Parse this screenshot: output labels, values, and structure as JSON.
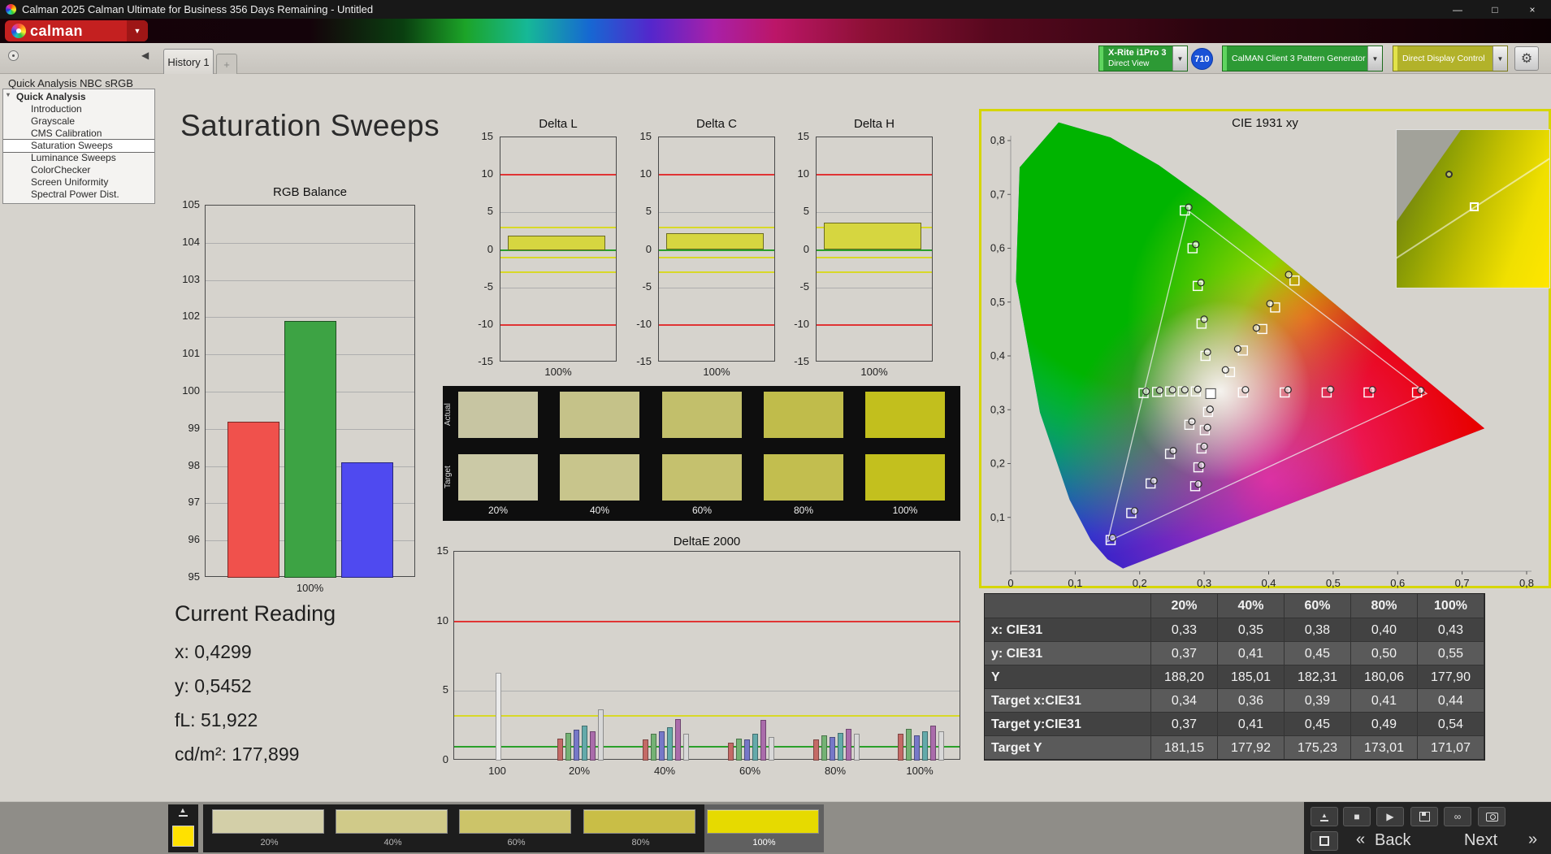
{
  "window": {
    "title": "Calman 2025 Calman Ultimate for Business 356 Days Remaining  - Untitled"
  },
  "logo": {
    "text": "calman"
  },
  "tabs": {
    "history": "History 1",
    "add": "+"
  },
  "toolbar": {
    "meter_line1": "X-Rite i1Pro 3",
    "meter_line2": "Direct View",
    "badge": "710",
    "pattern_generator": "CalMAN Client 3 Pattern Generator",
    "display_control": "Direct Display Control"
  },
  "icons": {
    "dropdown_arrow": "▼",
    "gear": "⚙",
    "minimize": "—",
    "maximize": "□",
    "close": "×",
    "collapse_left": "◀",
    "stop": "■",
    "play": "▶",
    "infinity": "∞",
    "back_chevrons": "«",
    "next_chevrons": "»"
  },
  "sidebar": {
    "header": "Quick Analysis NBC sRGB",
    "root": "Quick Analysis",
    "items": [
      {
        "label": "Introduction"
      },
      {
        "label": "Grayscale"
      },
      {
        "label": "CMS Calibration"
      },
      {
        "label": "Saturation Sweeps",
        "selected": true
      },
      {
        "label": "Luminance Sweeps"
      },
      {
        "label": "ColorChecker"
      },
      {
        "label": "Screen Uniformity"
      },
      {
        "label": "Spectral Power Dist."
      }
    ]
  },
  "main": {
    "title": "Saturation Sweeps"
  },
  "current_reading": {
    "title": "Current Reading",
    "line_x": "x: 0,4299",
    "line_y": "y: 0,5452",
    "line_fl": "fL: 51,922",
    "line_cd": "cd/m²: 177,899"
  },
  "swatch_grid": {
    "row_labels": [
      "Actual",
      "Target"
    ],
    "col_labels": [
      "20%",
      "40%",
      "60%",
      "80%",
      "100%"
    ],
    "actual_colors": [
      "#c7c5a2",
      "#c5c289",
      "#c2bf6b",
      "#c0bc4b",
      "#c2bf1d"
    ],
    "target_colors": [
      "#cbc9a6",
      "#c8c58c",
      "#c5c16e",
      "#c2be4f",
      "#c3c01e"
    ]
  },
  "chart_data": {
    "rgb_balance": {
      "type": "bar",
      "title": "RGB Balance",
      "categories": [
        "Red",
        "Green",
        "Blue"
      ],
      "values": [
        99.2,
        101.9,
        98.1
      ],
      "colors": [
        "#f0514c",
        "#3da344",
        "#4f4af0"
      ],
      "ylim": [
        95,
        105
      ],
      "ytick": 1,
      "xlabel": "100%"
    },
    "delta_l": {
      "type": "bar",
      "title": "Delta L",
      "categories": [
        "100%"
      ],
      "values": [
        1.9
      ],
      "bar_color": "#d6d640",
      "ylim": [
        -15,
        15
      ],
      "ytick": 5,
      "xlabel": "100%",
      "ref_lines": [
        {
          "y": 10,
          "color": "#e03434"
        },
        {
          "y": -10,
          "color": "#e03434"
        },
        {
          "y": 3,
          "color": "#d8d828"
        },
        {
          "y": -1,
          "color": "#d8d828"
        },
        {
          "y": -3,
          "color": "#d8d828"
        },
        {
          "y": 0,
          "color": "#2aa02a"
        }
      ]
    },
    "delta_c": {
      "type": "bar",
      "title": "Delta C",
      "categories": [
        "100%"
      ],
      "values": [
        2.2
      ],
      "bar_color": "#d6d640",
      "ylim": [
        -15,
        15
      ],
      "ytick": 5,
      "xlabel": "100%",
      "ref_lines": [
        {
          "y": 10,
          "color": "#e03434"
        },
        {
          "y": -10,
          "color": "#e03434"
        },
        {
          "y": 3,
          "color": "#d8d828"
        },
        {
          "y": -1,
          "color": "#d8d828"
        },
        {
          "y": -3,
          "color": "#d8d828"
        },
        {
          "y": 0,
          "color": "#2aa02a"
        }
      ]
    },
    "delta_h": {
      "type": "bar",
      "title": "Delta H",
      "categories": [
        "100%"
      ],
      "values": [
        3.6
      ],
      "bar_color": "#d6d640",
      "ylim": [
        -15,
        15
      ],
      "ytick": 5,
      "xlabel": "100%",
      "ref_lines": [
        {
          "y": 10,
          "color": "#e03434"
        },
        {
          "y": -10,
          "color": "#e03434"
        },
        {
          "y": 3,
          "color": "#d8d828"
        },
        {
          "y": -1,
          "color": "#d8d828"
        },
        {
          "y": -3,
          "color": "#d8d828"
        },
        {
          "y": 0,
          "color": "#2aa02a"
        }
      ]
    },
    "deltae2000": {
      "type": "bar",
      "title": "DeltaE 2000",
      "ylim": [
        0,
        15
      ],
      "yticks": [
        0,
        5,
        10,
        15
      ],
      "ref_lines": [
        {
          "y": 10,
          "color": "#e03434"
        },
        {
          "y": 3.2,
          "color": "#d8d828"
        },
        {
          "y": 1,
          "color": "#2aa02a"
        }
      ],
      "bar_colors": [
        "#c46a66",
        "#74b274",
        "#7678c8",
        "#64aaaa",
        "#aa6cab",
        "#d8d8d8"
      ],
      "groups": [
        {
          "label": "100",
          "values": [
            6.3
          ],
          "colors": [
            "#ebebeb"
          ]
        },
        {
          "label": "20%",
          "values": [
            1.6,
            2.0,
            2.2,
            2.5,
            2.1,
            3.7
          ]
        },
        {
          "label": "40%",
          "values": [
            1.5,
            1.9,
            2.1,
            2.4,
            3.0,
            1.9
          ]
        },
        {
          "label": "60%",
          "values": [
            1.3,
            1.6,
            1.5,
            1.9,
            2.9,
            1.7
          ]
        },
        {
          "label": "80%",
          "values": [
            1.5,
            1.8,
            1.7,
            2.0,
            2.3,
            1.9
          ]
        },
        {
          "label": "100%",
          "values": [
            1.9,
            2.3,
            1.8,
            2.1,
            2.5,
            2.1
          ]
        }
      ]
    },
    "cie": {
      "type": "scatter",
      "title": "CIE 1931 xy",
      "xlim": [
        0,
        0.8
      ],
      "ylim": [
        0,
        0.8
      ],
      "tick": 0.1,
      "gamut_triangle": [
        [
          0.645,
          0.33
        ],
        [
          0.275,
          0.67
        ],
        [
          0.15,
          0.055
        ]
      ],
      "white_point": [
        0.31,
        0.33
      ],
      "targets": [
        [
          0.34,
          0.37
        ],
        [
          0.36,
          0.41
        ],
        [
          0.39,
          0.45
        ],
        [
          0.41,
          0.49
        ],
        [
          0.44,
          0.54
        ],
        [
          0.36,
          0.332
        ],
        [
          0.425,
          0.332
        ],
        [
          0.49,
          0.332
        ],
        [
          0.555,
          0.332
        ],
        [
          0.63,
          0.332
        ],
        [
          0.302,
          0.4
        ],
        [
          0.296,
          0.46
        ],
        [
          0.29,
          0.53
        ],
        [
          0.282,
          0.6
        ],
        [
          0.27,
          0.67
        ],
        [
          0.277,
          0.272
        ],
        [
          0.247,
          0.218
        ],
        [
          0.217,
          0.163
        ],
        [
          0.187,
          0.108
        ],
        [
          0.155,
          0.058
        ],
        [
          0.306,
          0.296
        ],
        [
          0.301,
          0.262
        ],
        [
          0.296,
          0.228
        ],
        [
          0.291,
          0.193
        ],
        [
          0.286,
          0.158
        ],
        [
          0.287,
          0.334
        ],
        [
          0.267,
          0.334
        ],
        [
          0.247,
          0.334
        ],
        [
          0.227,
          0.333
        ],
        [
          0.206,
          0.331
        ]
      ],
      "measured": [
        [
          0.333,
          0.374
        ],
        [
          0.352,
          0.413
        ],
        [
          0.381,
          0.452
        ],
        [
          0.402,
          0.497
        ],
        [
          0.431,
          0.551
        ],
        [
          0.364,
          0.337
        ],
        [
          0.43,
          0.337
        ],
        [
          0.496,
          0.338
        ],
        [
          0.561,
          0.337
        ],
        [
          0.636,
          0.336
        ],
        [
          0.305,
          0.407
        ],
        [
          0.3,
          0.468
        ],
        [
          0.295,
          0.536
        ],
        [
          0.287,
          0.607
        ],
        [
          0.276,
          0.676
        ],
        [
          0.281,
          0.278
        ],
        [
          0.252,
          0.224
        ],
        [
          0.222,
          0.168
        ],
        [
          0.192,
          0.112
        ],
        [
          0.158,
          0.062
        ],
        [
          0.309,
          0.301
        ],
        [
          0.305,
          0.267
        ],
        [
          0.3,
          0.232
        ],
        [
          0.296,
          0.197
        ],
        [
          0.291,
          0.162
        ],
        [
          0.29,
          0.338
        ],
        [
          0.27,
          0.337
        ],
        [
          0.251,
          0.337
        ],
        [
          0.231,
          0.336
        ],
        [
          0.21,
          0.334
        ]
      ]
    }
  },
  "table": {
    "columns": [
      "",
      "20%",
      "40%",
      "60%",
      "80%",
      "100%"
    ],
    "rows": [
      {
        "label": "x: CIE31",
        "values": [
          "0,33",
          "0,35",
          "0,38",
          "0,40",
          "0,43"
        ]
      },
      {
        "label": "y: CIE31",
        "values": [
          "0,37",
          "0,41",
          "0,45",
          "0,50",
          "0,55"
        ]
      },
      {
        "label": "Y",
        "values": [
          "188,20",
          "185,01",
          "182,31",
          "180,06",
          "177,90"
        ]
      },
      {
        "label": "Target x:CIE31",
        "values": [
          "0,34",
          "0,36",
          "0,39",
          "0,41",
          "0,44"
        ]
      },
      {
        "label": "Target y:CIE31",
        "values": [
          "0,37",
          "0,41",
          "0,45",
          "0,49",
          "0,54"
        ]
      },
      {
        "label": "Target Y",
        "values": [
          "181,15",
          "177,92",
          "175,23",
          "173,01",
          "171,07"
        ]
      }
    ]
  },
  "bottom": {
    "current_color": "#ffe100",
    "swatches": [
      {
        "label": "20%",
        "color": "#d3cfa8"
      },
      {
        "label": "40%",
        "color": "#d0ca89"
      },
      {
        "label": "60%",
        "color": "#ccc469"
      },
      {
        "label": "80%",
        "color": "#c9be46"
      },
      {
        "label": "100%",
        "color": "#e6da00",
        "selected": true
      }
    ],
    "back": "Back",
    "next": "Next"
  }
}
